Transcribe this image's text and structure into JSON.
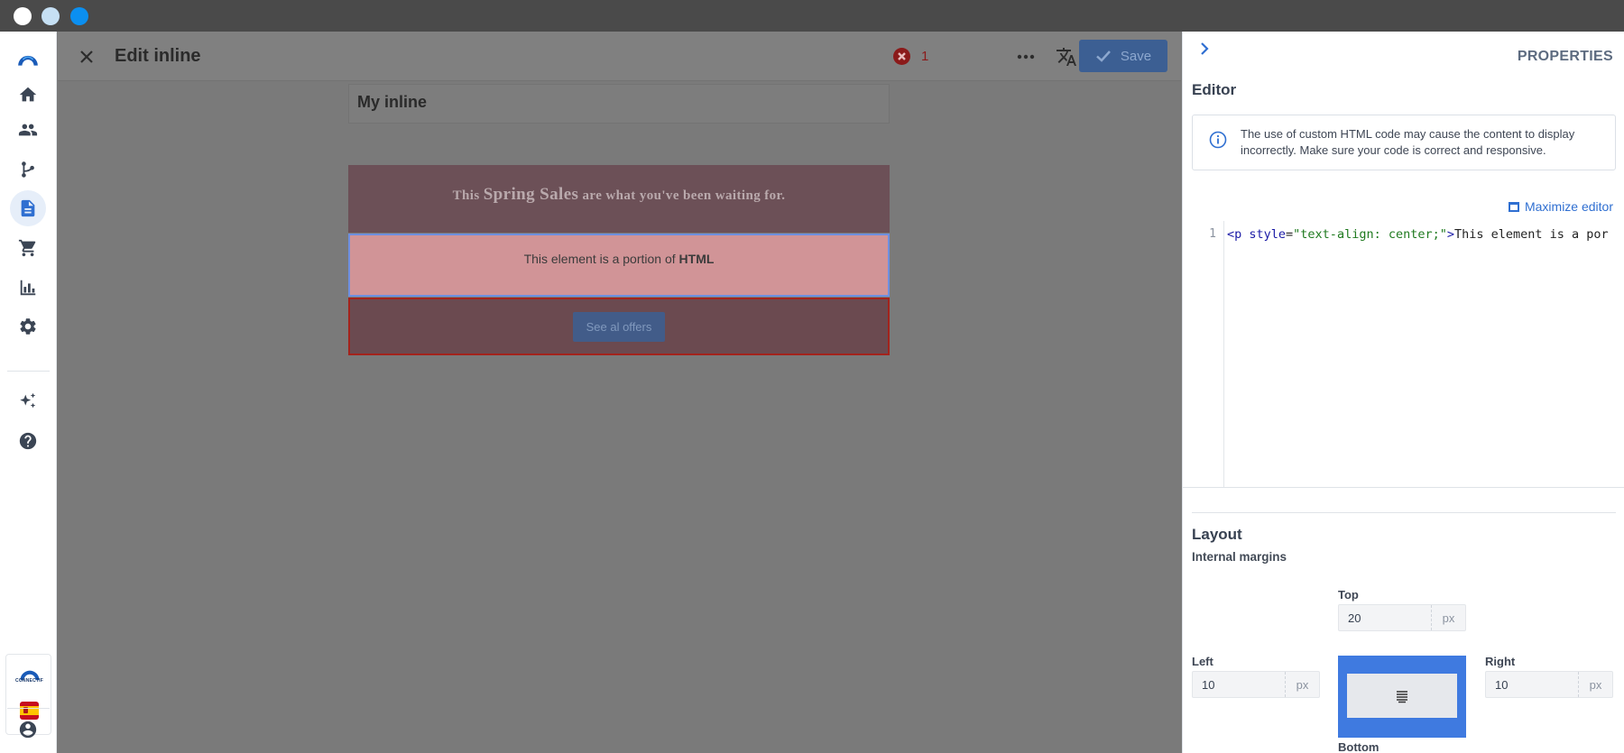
{
  "window": {
    "dots": [
      "white",
      "light-blue",
      "blue"
    ]
  },
  "nav": {
    "items": [
      "logo",
      "home",
      "contacts",
      "journeys",
      "content",
      "ecommerce",
      "analytics",
      "settings",
      "ai-sparkle",
      "help"
    ],
    "brand_text": "CONNECTIF",
    "active": "content"
  },
  "topbar": {
    "title": "Edit inline",
    "error_count": "1",
    "save_label": "Save"
  },
  "canvas": {
    "inline_name": "My inline",
    "banner": {
      "prefix": "This ",
      "highlight": "Spring Sales",
      "suffix": " are what you've been waiting for."
    },
    "html_block": {
      "prefix": "This element is a portion of ",
      "bold": "HTML"
    },
    "button_label": "See al offers"
  },
  "panel": {
    "title": "PROPERTIES",
    "editor_title": "Editor",
    "info_text": "The use of custom HTML code may cause the content to display incorrectly. Make sure your code is correct and responsive.",
    "maximize_label": "Maximize editor",
    "code": {
      "line_number": "1",
      "tag_open": "<p ",
      "attr": "style",
      "eq": "=",
      "value": "\"text-align: center;\"",
      "close": ">",
      "text": "This element is a por"
    },
    "layout_title": "Layout",
    "internal_margins": "Internal margins",
    "margins": {
      "top": {
        "label": "Top",
        "value": "20",
        "unit": "px"
      },
      "left": {
        "label": "Left",
        "value": "10",
        "unit": "px"
      },
      "right": {
        "label": "Right",
        "value": "10",
        "unit": "px"
      },
      "bottom": {
        "label": "Bottom"
      }
    }
  },
  "colors": {
    "accent": "#2f6fd1",
    "error": "#8b1a1a",
    "selected_border": "#6e8fe0",
    "margin_preview": "#3f7ae0"
  }
}
